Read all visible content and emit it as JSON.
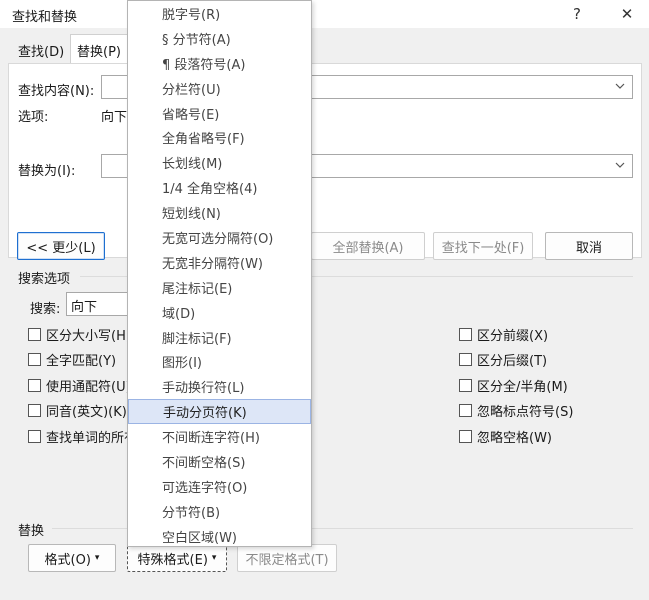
{
  "window": {
    "title": "查找和替换",
    "help": "?",
    "close": "✕"
  },
  "tabs": [
    {
      "label": "查找(D)",
      "active": false
    },
    {
      "label": "替换(P)",
      "active": true
    }
  ],
  "find": {
    "label": "查找内容(N):",
    "value": "",
    "options_label": "选项:",
    "options_value": "向下"
  },
  "replace": {
    "label": "替换为(I):",
    "value": ""
  },
  "buttons": {
    "less": "<< 更少(L)",
    "replace_all": "全部替换(A)",
    "find_next": "查找下一处(F)",
    "cancel": "取消"
  },
  "search_options": {
    "title": "搜索选项",
    "search_label": "搜索:",
    "search_value": "向下",
    "left": [
      {
        "label": "区分大小写(H)",
        "checked": false
      },
      {
        "label": "全字匹配(Y)",
        "checked": false
      },
      {
        "label": "使用通配符(U)",
        "checked": false
      },
      {
        "label": "同音(英文)(K)",
        "checked": false
      },
      {
        "label": "查找单词的所有形式(英文)(W)",
        "checked": false
      }
    ],
    "right": [
      {
        "label": "区分前缀(X)",
        "checked": false
      },
      {
        "label": "区分后缀(T)",
        "checked": false
      },
      {
        "label": "区分全/半角(M)",
        "checked": false
      },
      {
        "label": "忽略标点符号(S)",
        "checked": false
      },
      {
        "label": "忽略空格(W)",
        "checked": false
      }
    ]
  },
  "replace_section": {
    "title": "替换",
    "format": "格式(O)",
    "special": "特殊格式(E)",
    "no_format": "不限定格式(T)"
  },
  "special_menu": {
    "items": [
      "脱字号(R)",
      "§ 分节符(A)",
      "¶ 段落符号(A)",
      "分栏符(U)",
      "省略号(E)",
      "全角省略号(F)",
      "长划线(M)",
      "1/4 全角空格(4)",
      "短划线(N)",
      "无宽可选分隔符(O)",
      "无宽非分隔符(W)",
      "尾注标记(E)",
      "域(D)",
      "脚注标记(F)",
      "图形(I)",
      "手动换行符(L)",
      "手动分页符(K)",
      "不间断连字符(H)",
      "不间断空格(S)",
      "可选连字符(O)",
      "分节符(B)",
      "空白区域(W)"
    ],
    "selected": "手动分页符(K)"
  }
}
